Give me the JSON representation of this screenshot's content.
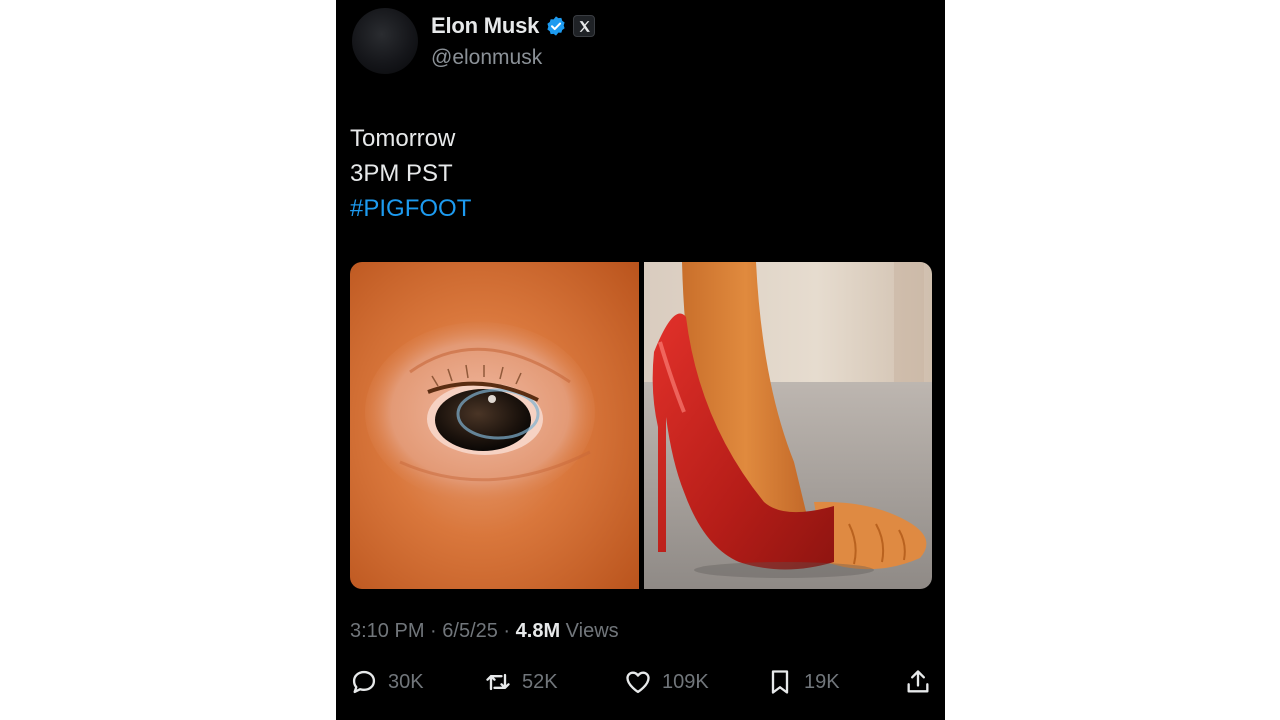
{
  "author": {
    "display_name": "Elon Musk",
    "handle": "@elonmusk",
    "verified_icon": "verified-badge-icon",
    "affiliation_icon": "x-logo-icon"
  },
  "tweet": {
    "lines": [
      "Tomorrow",
      "3PM PST"
    ],
    "hashtag": "#PIGFOOT"
  },
  "media": [
    {
      "icon": "pig-eye-image"
    },
    {
      "icon": "red-high-heel-pig-foot-image"
    }
  ],
  "meta": {
    "time": "3:10 PM",
    "sep1": " · ",
    "date": "6/5/25",
    "sep2": " · ",
    "views_count": "4.8M",
    "views_label": " Views"
  },
  "actions": {
    "replies": "30K",
    "reposts": "52K",
    "likes": "109K",
    "bookmarks": "19K"
  },
  "colors": {
    "background": "#000000",
    "text": "#e7e9ea",
    "muted": "#71767b",
    "accent": "#1d9bf0"
  }
}
